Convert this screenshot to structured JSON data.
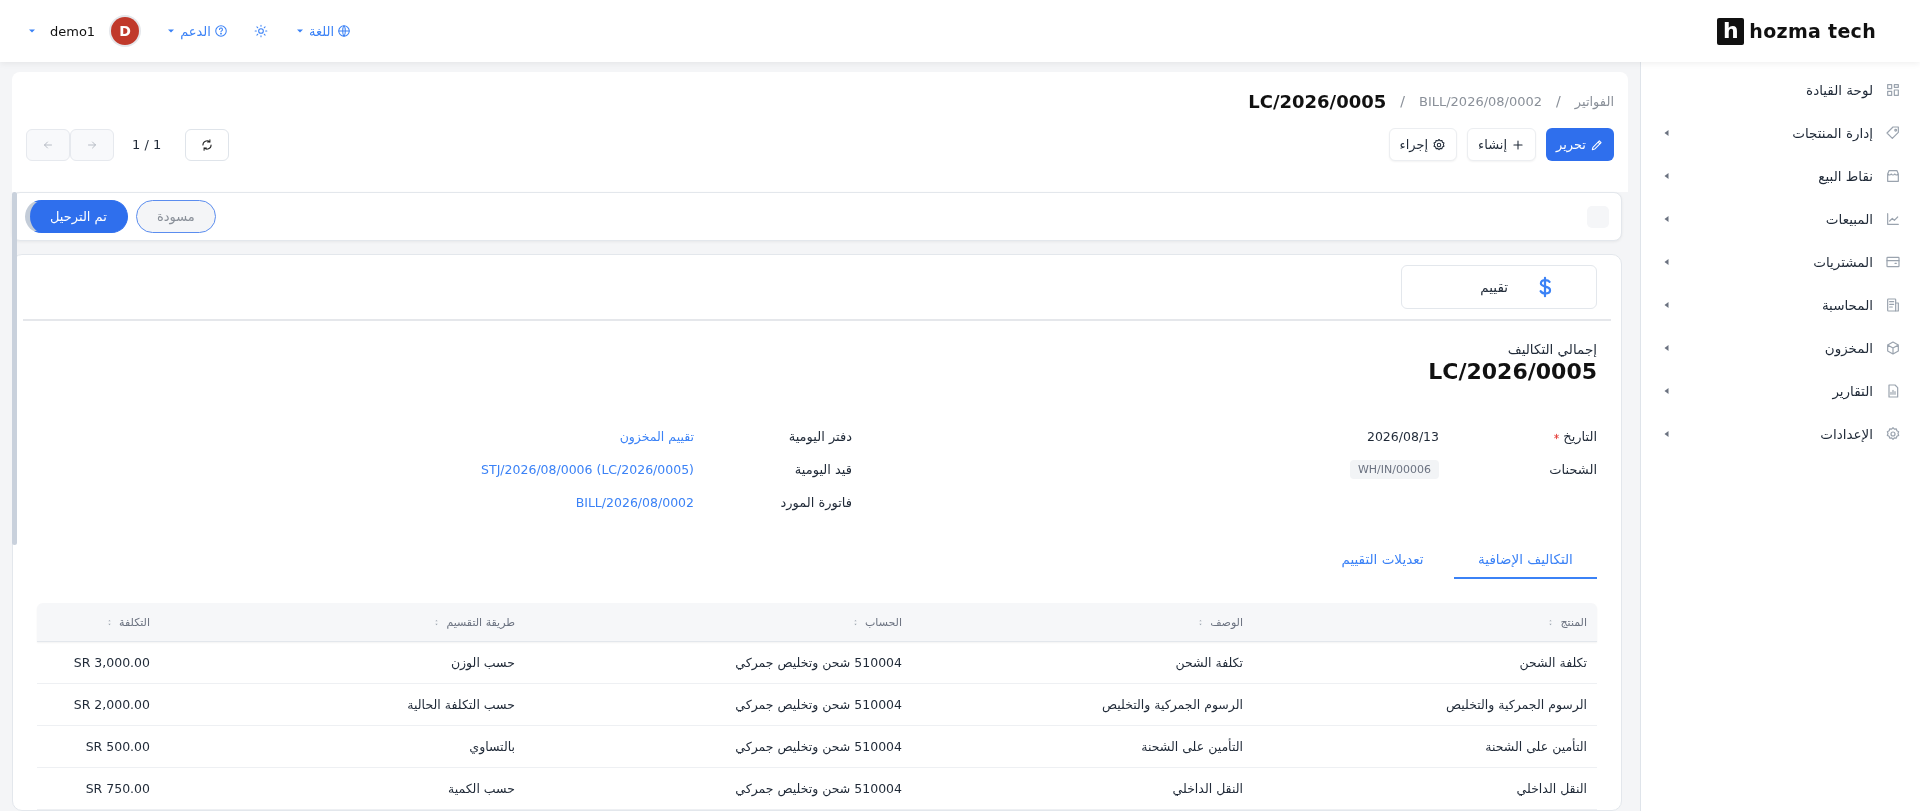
{
  "topbar": {
    "logo": {
      "mark": "h",
      "text": "hozma tech"
    },
    "language": "اللغة",
    "support": "الدعم",
    "user": {
      "initial": "D",
      "name": "demo1"
    }
  },
  "sidebar": {
    "items": [
      {
        "label": "لوحة القيادة",
        "expandable": false
      },
      {
        "label": "إدارة المنتجات",
        "expandable": true
      },
      {
        "label": "نقاط البيع",
        "expandable": true
      },
      {
        "label": "المبيعات",
        "expandable": true
      },
      {
        "label": "المشتريات",
        "expandable": true
      },
      {
        "label": "المحاسبة",
        "expandable": true
      },
      {
        "label": "المخزون",
        "expandable": true
      },
      {
        "label": "التقارير",
        "expandable": true
      },
      {
        "label": "الإعدادات",
        "expandable": true
      }
    ]
  },
  "breadcrumb": {
    "separator": "/",
    "items": [
      "الفواتير",
      "BILL/2026/08/0002"
    ],
    "current": "LC/2026/0005"
  },
  "actions": [
    {
      "label": "تحرير",
      "kind": "edit"
    },
    {
      "label": "إنشاء",
      "kind": "create"
    },
    {
      "label": "إجراء",
      "kind": "action"
    }
  ],
  "pager": {
    "text": "1 / 1",
    "previous_disabled": true,
    "next_disabled": true
  },
  "status_steps": [
    {
      "label": "مسودة",
      "selected": false
    },
    {
      "label": "تم الترحيل",
      "selected": true
    }
  ],
  "smart_button": {
    "label": "تقييم"
  },
  "record": {
    "caption": "إجمالي التكاليف",
    "title": "LC/2026/0005"
  },
  "fields_right": [
    {
      "label": "التاريخ",
      "required": true,
      "kind": "text",
      "value": "2026/08/13"
    },
    {
      "label": "الشحنات",
      "required": false,
      "kind": "tag",
      "value": "WH/IN/00006"
    }
  ],
  "fields_left": [
    {
      "label": "دفتر اليومية",
      "required": false,
      "kind": "link",
      "value": "تقييم المخزون"
    },
    {
      "label": "قيد اليومية",
      "required": false,
      "kind": "link",
      "value": "STJ/2026/08/0006 (LC/2026/0005)"
    },
    {
      "label": "فاتورة المورد",
      "required": false,
      "kind": "link",
      "value": "BILL/2026/08/0002"
    }
  ],
  "tabs": [
    {
      "label": "التكاليف الإضافية",
      "selected": true
    },
    {
      "label": "تعديلات التقييم",
      "selected": false
    }
  ],
  "table": {
    "columns": [
      "المنتج",
      "الوصف",
      "الحساب",
      "طريقة التقسيم",
      "التكلفة"
    ],
    "rows": [
      [
        "تكلفة الشحن",
        "تكلفة الشحن",
        "510004 شحن وتخليص جمركي",
        "حسب الوزن",
        "SR 3,000.00"
      ],
      [
        "الرسوم الجمركية والتخليص",
        "الرسوم الجمركية والتخليص",
        "510004 شحن وتخليص جمركي",
        "حسب التكلفة الحالية",
        "SR 2,000.00"
      ],
      [
        "التأمين على الشحنة",
        "التأمين على الشحنة",
        "510004 شحن وتخليص جمركي",
        "بالتساوي",
        "SR 500.00"
      ],
      [
        "النقل الداخلي",
        "النقل الداخلي",
        "510004 شحن وتخليص جمركي",
        "حسب الكمية",
        "SR 750.00"
      ]
    ]
  }
}
